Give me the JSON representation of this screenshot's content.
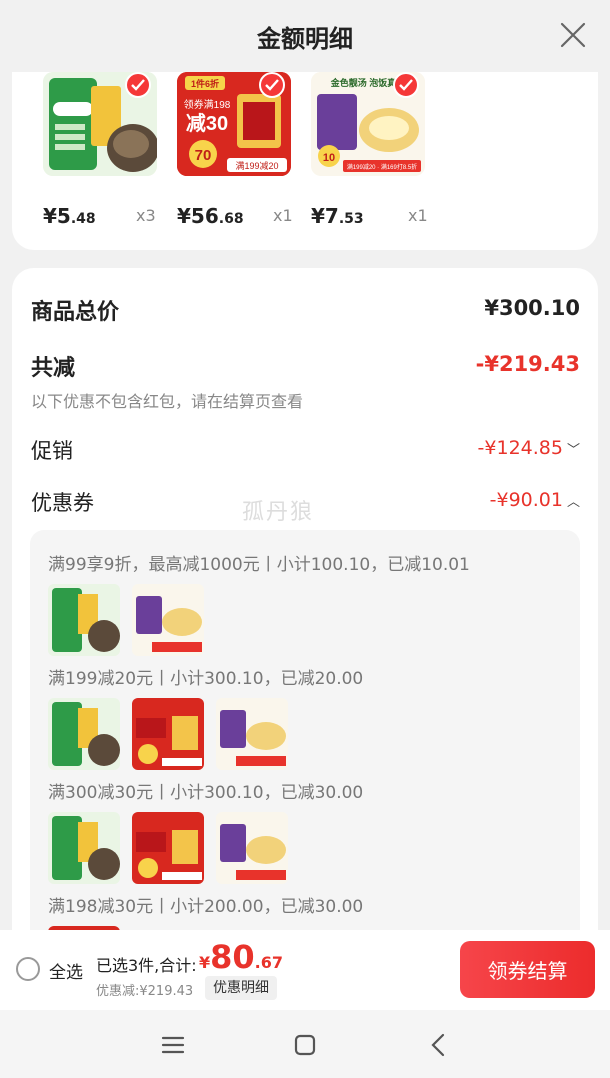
{
  "header": {
    "title": "金额明细"
  },
  "products": [
    {
      "price_symbol": "¥",
      "price_int": "5",
      "price_dec": ".48",
      "qty": "x3",
      "image": "seasoning-pack-green"
    },
    {
      "price_symbol": "¥",
      "price_int": "56",
      "price_dec": ".68",
      "qty": "x1",
      "image": "seasoning-pack-red",
      "image_text": {
        "tag": "1件6折",
        "line1": "领券满198",
        "line2": "减30",
        "badge": "70",
        "strip": "满199减20"
      }
    },
    {
      "price_symbol": "¥",
      "price_int": "7",
      "price_dec": ".53",
      "qty": "x1",
      "image": "soup-pack",
      "image_text": {
        "head": "金色靓汤 泡饭真香",
        "badge": "10",
        "strip": "满199减20 · 满169打8.5折"
      }
    }
  ],
  "summary": {
    "total_label": "商品总价",
    "total_value": "¥300.10",
    "reduce_label": "共减",
    "reduce_value": "-¥219.43",
    "note": "以下优惠不包含红包，请在结算页查看",
    "promo_label": "促销",
    "promo_value": "-¥124.85",
    "coupon_label": "优惠券",
    "coupon_value": "-¥90.01"
  },
  "coupons": [
    {
      "text": "满99享9折，最高减1000元丨小计100.10，已减10.01",
      "thumbs": [
        "seasoning-pack-green",
        "soup-pack"
      ]
    },
    {
      "text": "满199减20元丨小计300.10，已减20.00",
      "thumbs": [
        "seasoning-pack-green",
        "seasoning-pack-red",
        "soup-pack"
      ]
    },
    {
      "text": "满300减30元丨小计300.10，已减30.00",
      "thumbs": [
        "seasoning-pack-green",
        "seasoning-pack-red",
        "soup-pack"
      ]
    },
    {
      "text": "满198减30元丨小计200.00，已减30.00",
      "thumbs": [
        "seasoning-pack-red"
      ]
    }
  ],
  "watermark": "孤丹狼",
  "bottom": {
    "select_all": "全选",
    "selected": "已选3件,合计:",
    "total_symbol": "¥",
    "total_int": "80",
    "total_dec": ".67",
    "discount": "优惠减:¥219.43",
    "detail_button": "优惠明细",
    "checkout_button": "领券结算"
  },
  "colors": {
    "accent": "#e8332b",
    "checkout": "#f24040",
    "background": "#f1f1f1"
  }
}
